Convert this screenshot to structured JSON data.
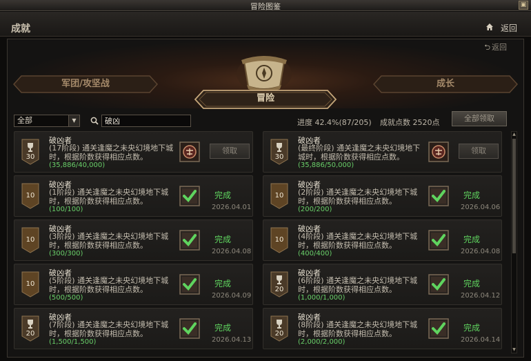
{
  "window": {
    "title": "冒险图鉴",
    "control_icon": "restore-icon"
  },
  "header": {
    "title": "成就",
    "back_label": "返回",
    "home_icon": "home-icon"
  },
  "panel": {
    "sub_back_label": "返回"
  },
  "tabs": {
    "left": "军团/攻坚战",
    "center": "冒险",
    "right": "成长",
    "active": "center"
  },
  "filter": {
    "selected": "全部"
  },
  "search": {
    "value": "破凶"
  },
  "stats": {
    "progress_label": "进度 42.4%(87/205)",
    "points_label": "成就点数 2520点",
    "progress_fraction": 0.424
  },
  "claim_all_label": "全部领取",
  "colors": {
    "complete": "#5fd45f",
    "progress": "#6ad06a",
    "badge_dark": "#3a2a1a",
    "accent": "#c9a46a"
  },
  "achievements": [
    {
      "name": "破凶者",
      "desc": "(17阶段) 通关逢魔之未央幻境地下城时，根据阶数获得相应点数。",
      "progress": "(35,886/40,000)",
      "points": "30",
      "badge": "trophy",
      "state": "claim",
      "claim_label": "领取",
      "reward_icon": "locked-reward-icon"
    },
    {
      "name": "破凶者",
      "desc": "(最终阶段) 通关逢魔之未央幻境地下城时，根据阶数获得相应点数。",
      "progress": "(35,886/50,000)",
      "points": "30",
      "badge": "trophy",
      "state": "claim",
      "claim_label": "领取",
      "reward_icon": "locked-reward-icon"
    },
    {
      "name": "破凶者",
      "desc": "(1阶段) 通关逢魔之未央幻境地下城时，根据阶数获得相应点数。",
      "progress": "(100/100)",
      "points": "10",
      "badge": "plain",
      "state": "done",
      "status": "完成",
      "date": "2026.04.01"
    },
    {
      "name": "破凶者",
      "desc": "(2阶段) 通关逢魔之未央幻境地下城时，根据阶数获得相应点数。",
      "progress": "(200/200)",
      "points": "10",
      "badge": "plain",
      "state": "done",
      "status": "完成",
      "date": "2026.04.06"
    },
    {
      "name": "破凶者",
      "desc": "(3阶段) 通关逢魔之未央幻境地下城时，根据阶数获得相应点数。",
      "progress": "(300/300)",
      "points": "10",
      "badge": "plain",
      "state": "done",
      "status": "完成",
      "date": "2026.04.08"
    },
    {
      "name": "破凶者",
      "desc": "(4阶段) 通关逢魔之未央幻境地下城时，根据阶数获得相应点数。",
      "progress": "(400/400)",
      "points": "10",
      "badge": "plain",
      "state": "done",
      "status": "完成",
      "date": "2026.04.08"
    },
    {
      "name": "破凶者",
      "desc": "(5阶段) 通关逢魔之未央幻境地下城时，根据阶数获得相应点数。",
      "progress": "(500/500)",
      "points": "10",
      "badge": "plain",
      "state": "done",
      "status": "完成",
      "date": "2026.04.09"
    },
    {
      "name": "破凶者",
      "desc": "(6阶段) 通关逢魔之未央幻境地下城时，根据阶数获得相应点数。",
      "progress": "(1,000/1,000)",
      "points": "20",
      "badge": "trophy",
      "state": "done",
      "status": "完成",
      "date": "2026.04.12"
    },
    {
      "name": "破凶者",
      "desc": "(7阶段) 通关逢魔之未央幻境地下城时，根据阶数获得相应点数。",
      "progress": "(1,500/1,500)",
      "points": "20",
      "badge": "trophy",
      "state": "done",
      "status": "完成",
      "date": "2026.04.13"
    },
    {
      "name": "破凶者",
      "desc": "(8阶段) 通关逢魔之未央幻境地下城时，根据阶数获得相应点数。",
      "progress": "(2,000/2,000)",
      "points": "20",
      "badge": "trophy",
      "state": "done",
      "status": "完成",
      "date": "2026.04.14"
    }
  ]
}
